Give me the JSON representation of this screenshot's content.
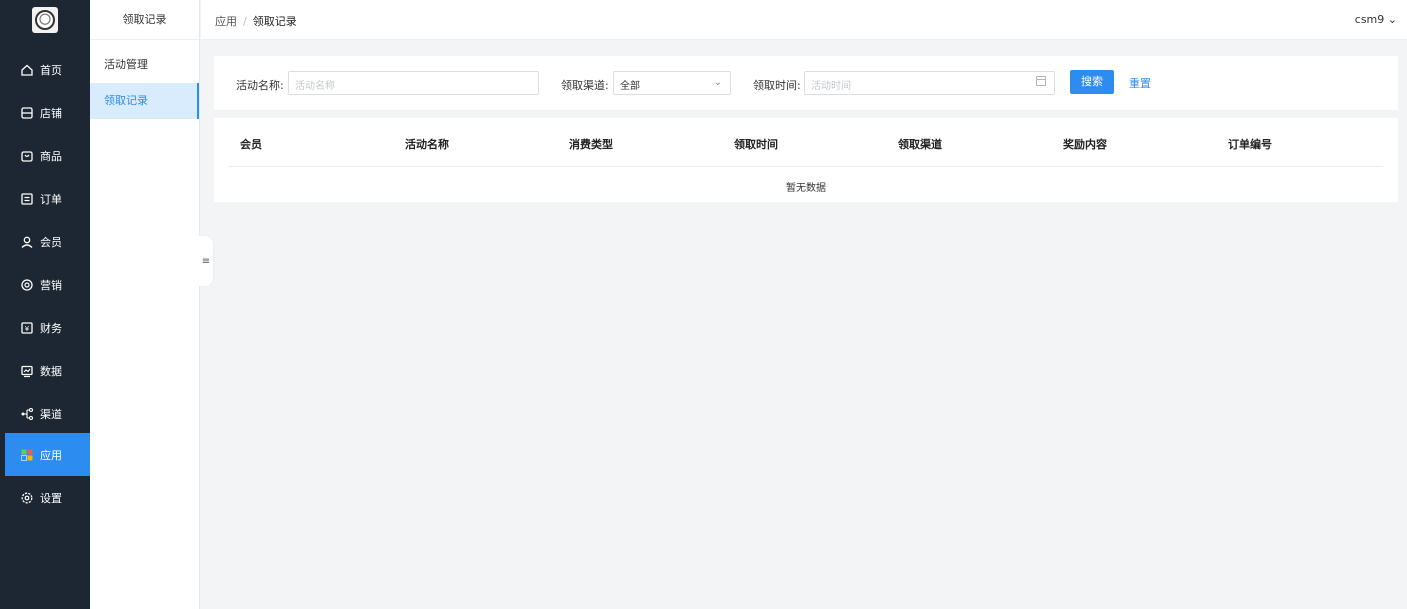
{
  "nav": {
    "items": [
      {
        "label": "首页",
        "icon": "home-icon"
      },
      {
        "label": "店铺",
        "icon": "store-icon"
      },
      {
        "label": "商品",
        "icon": "product-icon"
      },
      {
        "label": "订单",
        "icon": "order-icon"
      },
      {
        "label": "会员",
        "icon": "member-icon"
      },
      {
        "label": "营销",
        "icon": "marketing-icon"
      },
      {
        "label": "财务",
        "icon": "finance-icon"
      },
      {
        "label": "数据",
        "icon": "data-icon"
      },
      {
        "label": "渠道",
        "icon": "channel-icon"
      },
      {
        "label": "应用",
        "icon": "app-icon"
      },
      {
        "label": "设置",
        "icon": "settings-icon"
      }
    ],
    "active_index": 9
  },
  "submenu": {
    "title": "领取记录",
    "items": [
      {
        "label": "活动管理"
      },
      {
        "label": "领取记录"
      }
    ]
  },
  "header": {
    "breadcrumb": [
      "应用",
      "领取记录"
    ],
    "separator": "/",
    "user": "csm9",
    "user_chevron": "⌄"
  },
  "filter": {
    "name_label": "活动名称:",
    "name_placeholder": "活动名称",
    "channel_label": "领取渠道:",
    "channel_value": "全部",
    "time_label": "领取时间:",
    "time_placeholder": "活动时间",
    "search_label": "搜索",
    "reset_label": "重置"
  },
  "table": {
    "columns": [
      "会员",
      "活动名称",
      "消费类型",
      "领取时间",
      "领取渠道",
      "奖励内容",
      "订单编号"
    ],
    "empty_text": "暂无数据"
  },
  "colors": {
    "nav_bg": "#1d2733",
    "accent": "#2d8cf0",
    "submenu_active_bg": "#d9ecfd"
  }
}
